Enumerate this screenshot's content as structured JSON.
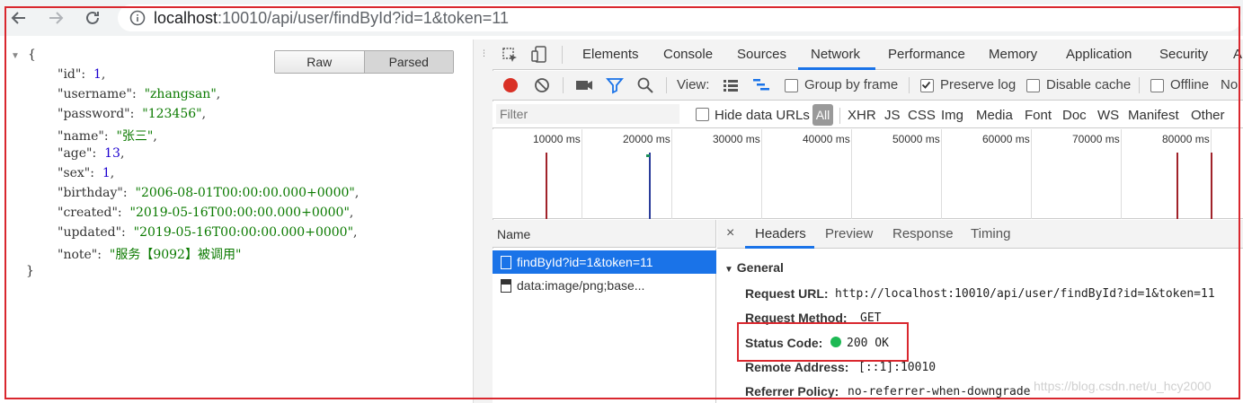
{
  "browser": {
    "url_host": "localhost",
    "url_rest": ":10010/api/user/findById?id=1&token=11",
    "back_icon": "arrow-left-icon",
    "forward_icon": "arrow-right-icon",
    "reload_icon": "reload-icon",
    "info_icon": "info-icon"
  },
  "viewer": {
    "raw_label": "Raw",
    "parsed_label": "Parsed",
    "open_brace": "{",
    "close_brace": "}",
    "fields": [
      {
        "key": "\"id\"",
        "value": "1",
        "type": "num"
      },
      {
        "key": "\"username\"",
        "value": "\"zhangsan\"",
        "type": "str"
      },
      {
        "key": "\"password\"",
        "value": "\"123456\"",
        "type": "str"
      },
      {
        "key": "\"name\"",
        "value": "\"张三\"",
        "type": "str"
      },
      {
        "key": "\"age\"",
        "value": "13",
        "type": "num"
      },
      {
        "key": "\"sex\"",
        "value": "1",
        "type": "num"
      },
      {
        "key": "\"birthday\"",
        "value": "\"2006-08-01T00:00:00.000+0000\"",
        "type": "str"
      },
      {
        "key": "\"created\"",
        "value": "\"2019-05-16T00:00:00.000+0000\"",
        "type": "str"
      },
      {
        "key": "\"updated\"",
        "value": "\"2019-05-16T00:00:00.000+0000\"",
        "type": "str"
      },
      {
        "key": "\"note\"",
        "value": "\"服务【9092】被调用\"",
        "type": "str"
      }
    ]
  },
  "devtools": {
    "tabs": [
      "Elements",
      "Console",
      "Sources",
      "Network",
      "Performance",
      "Memory",
      "Application",
      "Security",
      "A"
    ],
    "active_tab": "Network",
    "toolbar": {
      "view_label": "View:",
      "group_by_frame": "Group by frame",
      "preserve_log": "Preserve log",
      "disable_cache": "Disable cache",
      "offline": "Offline",
      "no_throttle": "No"
    },
    "filter": {
      "placeholder": "Filter",
      "hide_data_urls": "Hide data URLs",
      "all": "All",
      "types": [
        "XHR",
        "JS",
        "CSS",
        "Img",
        "Media",
        "Font",
        "Doc",
        "WS",
        "Manifest",
        "Other"
      ]
    },
    "timeline_ticks": [
      "10000 ms",
      "20000 ms",
      "30000 ms",
      "40000 ms",
      "50000 ms",
      "60000 ms",
      "70000 ms",
      "80000 ms"
    ],
    "list": {
      "header": "Name",
      "rows": [
        "findById?id=1&token=11",
        "data:image/png;base..."
      ]
    },
    "detail": {
      "close": "×",
      "tabs": [
        "Headers",
        "Preview",
        "Response",
        "Timing"
      ],
      "section": "General",
      "headers": [
        {
          "key": "Request URL:",
          "value": "http://localhost:10010/api/user/findById?id=1&token=11"
        },
        {
          "key": "Request Method:",
          "value": "GET"
        },
        {
          "key": "Status Code:",
          "value": "200 OK"
        },
        {
          "key": "Remote Address:",
          "value": "[::1]:10010"
        },
        {
          "key": "Referrer Policy:",
          "value": "no-referrer-when-downgrade"
        }
      ],
      "status_color": "#1db954"
    }
  },
  "watermark": "https://blog.csdn.net/u_hcy2000",
  "colors": {
    "accent": "#1a73e8",
    "highlight": "#d9272e"
  }
}
